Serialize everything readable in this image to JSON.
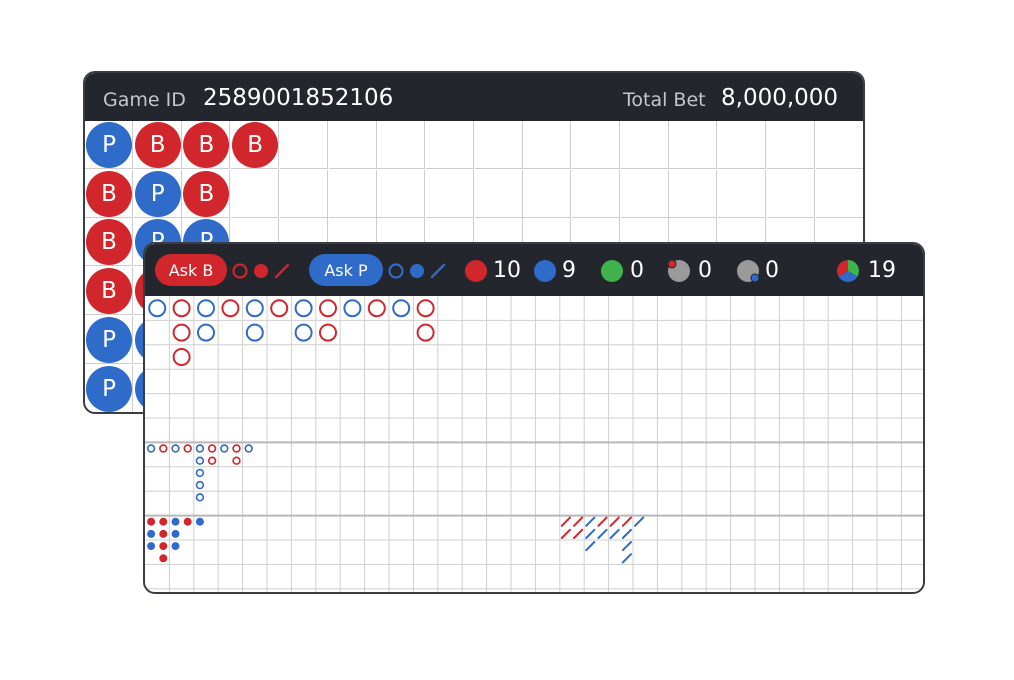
{
  "header": {
    "game_id_label": "Game ID",
    "game_id_value": "2589001852106",
    "total_bet_label": "Total Bet",
    "total_bet_value": "8,000,000"
  },
  "colors": {
    "banker": "#d0262c",
    "player": "#2f6bc8",
    "tie": "#3fb24b",
    "neutral": "#9a9a9a",
    "header_bg": "#23272d"
  },
  "bead_road": {
    "columns": [
      [
        "P",
        "B",
        "B",
        "B",
        "P",
        "P"
      ],
      [
        "B",
        "P",
        "P",
        "B",
        "P",
        "P"
      ],
      [
        "B",
        "B",
        "P",
        "",
        "",
        ""
      ],
      [
        "B",
        "",
        "",
        "",
        "",
        ""
      ]
    ]
  },
  "ask_banker": {
    "label": "Ask B",
    "predict_icons": [
      "hollow-circle-icon",
      "solid-dot-icon",
      "slash-icon"
    ]
  },
  "ask_player": {
    "label": "Ask P",
    "predict_icons": [
      "hollow-circle-icon",
      "solid-dot-icon",
      "slash-icon"
    ]
  },
  "stats": {
    "banker_count": "10",
    "player_count": "9",
    "tie_count": "0",
    "banker_pair_count": "0",
    "player_pair_count": "0",
    "total_count": "19"
  },
  "big_road": {
    "columns": [
      [
        "P"
      ],
      [
        "B",
        "B",
        "B"
      ],
      [
        "P",
        "P"
      ],
      [
        "B"
      ],
      [
        "P",
        "P"
      ],
      [
        "B"
      ],
      [
        "P",
        "P"
      ],
      [
        "B",
        "B"
      ],
      [
        "P"
      ],
      [
        "B"
      ],
      [
        "P"
      ],
      [
        "B",
        "B"
      ]
    ]
  },
  "big_eye_road": {
    "columns": [
      [
        "P"
      ],
      [
        "B"
      ],
      [
        "P"
      ],
      [
        "B"
      ],
      [
        "P",
        "P",
        "P",
        "P",
        "P"
      ],
      [
        "B",
        "B"
      ],
      [
        "P"
      ],
      [
        "B",
        "B"
      ],
      [
        "P"
      ]
    ]
  },
  "small_road": {
    "columns": [
      [
        "B",
        "P",
        "P"
      ],
      [
        "B",
        "B",
        "B",
        "B"
      ],
      [
        "P",
        "P",
        "P"
      ],
      [
        "B"
      ],
      [
        "P"
      ]
    ]
  },
  "cockroach_road": {
    "columns": [
      [
        "B",
        "B"
      ],
      [
        "B",
        "B"
      ],
      [
        "P",
        "P",
        "P"
      ],
      [
        "B",
        "P"
      ],
      [
        "B",
        "P"
      ],
      [
        "B",
        "P",
        "P",
        "P"
      ],
      [
        "P"
      ]
    ]
  }
}
